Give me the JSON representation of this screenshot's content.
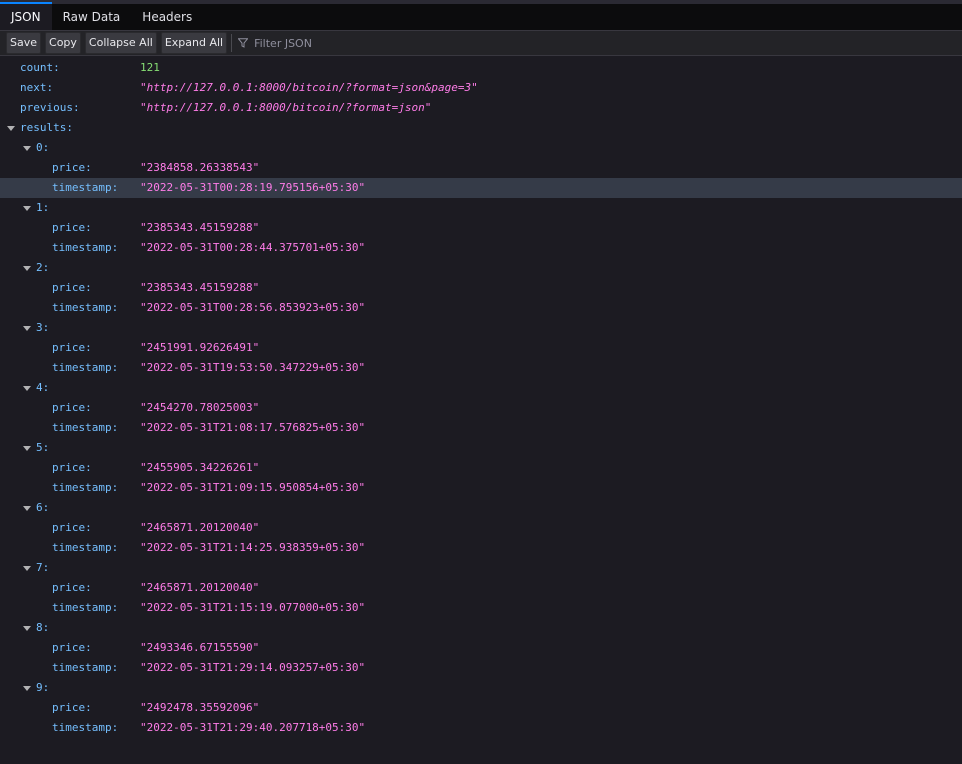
{
  "tabs": [
    {
      "label": "JSON",
      "active": true
    },
    {
      "label": "Raw Data",
      "active": false
    },
    {
      "label": "Headers",
      "active": false
    }
  ],
  "toolbar": {
    "save": "Save",
    "copy": "Copy",
    "collapse_all": "Collapse All",
    "expand_all": "Expand All",
    "filter_placeholder": "Filter JSON"
  },
  "json": {
    "count_key": "count:",
    "count_value": "121",
    "next_key": "next:",
    "next_value": "\"http://127.0.0.1:8000/bitcoin/?format=json&page=3\"",
    "previous_key": "previous:",
    "previous_value": "\"http://127.0.0.1:8000/bitcoin/?format=json\"",
    "results_key": "results:",
    "price_key": "price:",
    "timestamp_key": "timestamp:",
    "results": [
      {
        "index": "0:",
        "price": "\"2384858.26338543\"",
        "timestamp": "\"2022-05-31T00:28:19.795156+05:30\""
      },
      {
        "index": "1:",
        "price": "\"2385343.45159288\"",
        "timestamp": "\"2022-05-31T00:28:44.375701+05:30\""
      },
      {
        "index": "2:",
        "price": "\"2385343.45159288\"",
        "timestamp": "\"2022-05-31T00:28:56.853923+05:30\""
      },
      {
        "index": "3:",
        "price": "\"2451991.92626491\"",
        "timestamp": "\"2022-05-31T19:53:50.347229+05:30\""
      },
      {
        "index": "4:",
        "price": "\"2454270.78025003\"",
        "timestamp": "\"2022-05-31T21:08:17.576825+05:30\""
      },
      {
        "index": "5:",
        "price": "\"2455905.34226261\"",
        "timestamp": "\"2022-05-31T21:09:15.950854+05:30\""
      },
      {
        "index": "6:",
        "price": "\"2465871.20120040\"",
        "timestamp": "\"2022-05-31T21:14:25.938359+05:30\""
      },
      {
        "index": "7:",
        "price": "\"2465871.20120040\"",
        "timestamp": "\"2022-05-31T21:15:19.077000+05:30\""
      },
      {
        "index": "8:",
        "price": "\"2493346.67155590\"",
        "timestamp": "\"2022-05-31T21:29:14.093257+05:30\""
      },
      {
        "index": "9:",
        "price": "\"2492478.35592096\"",
        "timestamp": "\"2022-05-31T21:29:40.207718+05:30\""
      }
    ]
  }
}
